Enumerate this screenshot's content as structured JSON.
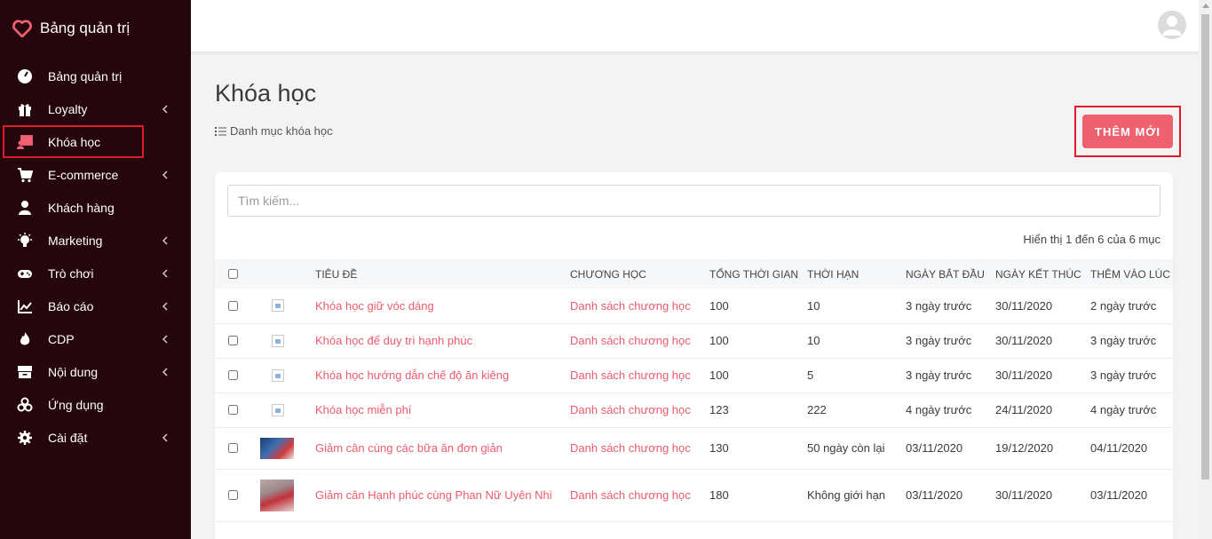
{
  "brand": {
    "title": "Bảng quản trị",
    "accent": "#f0616f"
  },
  "sidebar": {
    "items": [
      {
        "label": "Bảng quản trị",
        "icon": "dashboard-gauge-icon"
      },
      {
        "label": "Loyalty",
        "icon": "gift-icon",
        "has_children": true
      },
      {
        "label": "Khóa học",
        "icon": "course-teacher-icon",
        "active": true
      },
      {
        "label": "E-commerce",
        "icon": "cart-icon",
        "has_children": true
      },
      {
        "label": "Khách hàng",
        "icon": "user-icon"
      },
      {
        "label": "Marketing",
        "icon": "lightbulb-icon",
        "has_children": true
      },
      {
        "label": "Trò chơi",
        "icon": "gamepad-icon",
        "has_children": true
      },
      {
        "label": "Báo cáo",
        "icon": "chart-line-icon",
        "has_children": true
      },
      {
        "label": "CDP",
        "icon": "fire-icon",
        "has_children": true
      },
      {
        "label": "Nội dung",
        "icon": "inbox-icon",
        "has_children": true
      },
      {
        "label": "Ứng dụng",
        "icon": "cubes-icon"
      },
      {
        "label": "Cài đặt",
        "icon": "gear-icon",
        "has_children": true
      }
    ]
  },
  "page": {
    "title": "Khóa học",
    "breadcrumb": "Danh mục khóa học",
    "add_button": "THÊM MỚI"
  },
  "search": {
    "placeholder": "Tìm kiếm..."
  },
  "table": {
    "showing": "Hiển thị 1 đến 6 của 6 mục",
    "columns": [
      "TIÊU ĐỀ",
      "CHƯƠNG HỌC",
      "TỔNG THỜI GIAN",
      "THỜI HẠN",
      "NGÀY BẮT ĐẦU",
      "NGÀY KẾT THÚC",
      "THÊM VÀO LÚC"
    ],
    "rows": [
      {
        "title": "Khóa học giữ vóc dáng",
        "chapters": "Danh sách chương học",
        "total": "100",
        "duration": "10",
        "start": "3 ngày trước",
        "end": "30/11/2020",
        "added": "2 ngày trước",
        "thumb": "broken"
      },
      {
        "title": "Khóa học để duy trì hạnh phúc",
        "chapters": "Danh sách chương học",
        "total": "100",
        "duration": "10",
        "start": "3 ngày trước",
        "end": "30/11/2020",
        "added": "3 ngày trước",
        "thumb": "broken"
      },
      {
        "title": "Khóa học hướng dẫn chế độ ăn kiêng",
        "chapters": "Danh sách chương học",
        "total": "100",
        "duration": "5",
        "start": "3 ngày trước",
        "end": "30/11/2020",
        "added": "3 ngày trước",
        "thumb": "broken"
      },
      {
        "title": "Khóa học miễn phí",
        "chapters": "Danh sách chương học",
        "total": "123",
        "duration": "222",
        "start": "4 ngày trước",
        "end": "24/11/2020",
        "added": "4 ngày trước",
        "thumb": "broken"
      },
      {
        "title": "Giảm cân cùng các bữa ăn đơn giản",
        "chapters": "Danh sách chương học",
        "total": "130",
        "duration": "50 ngày còn lại",
        "start": "03/11/2020",
        "end": "19/12/2020",
        "added": "04/11/2020",
        "thumb": "photo-a"
      },
      {
        "title": "Giảm cân Hạnh phúc cùng Phan Nữ Uyên Nhi",
        "chapters": "Danh sách chương học",
        "total": "180",
        "duration": "Không giới hạn",
        "start": "03/11/2020",
        "end": "30/11/2020",
        "added": "03/11/2020",
        "thumb": "photo-b"
      }
    ]
  }
}
